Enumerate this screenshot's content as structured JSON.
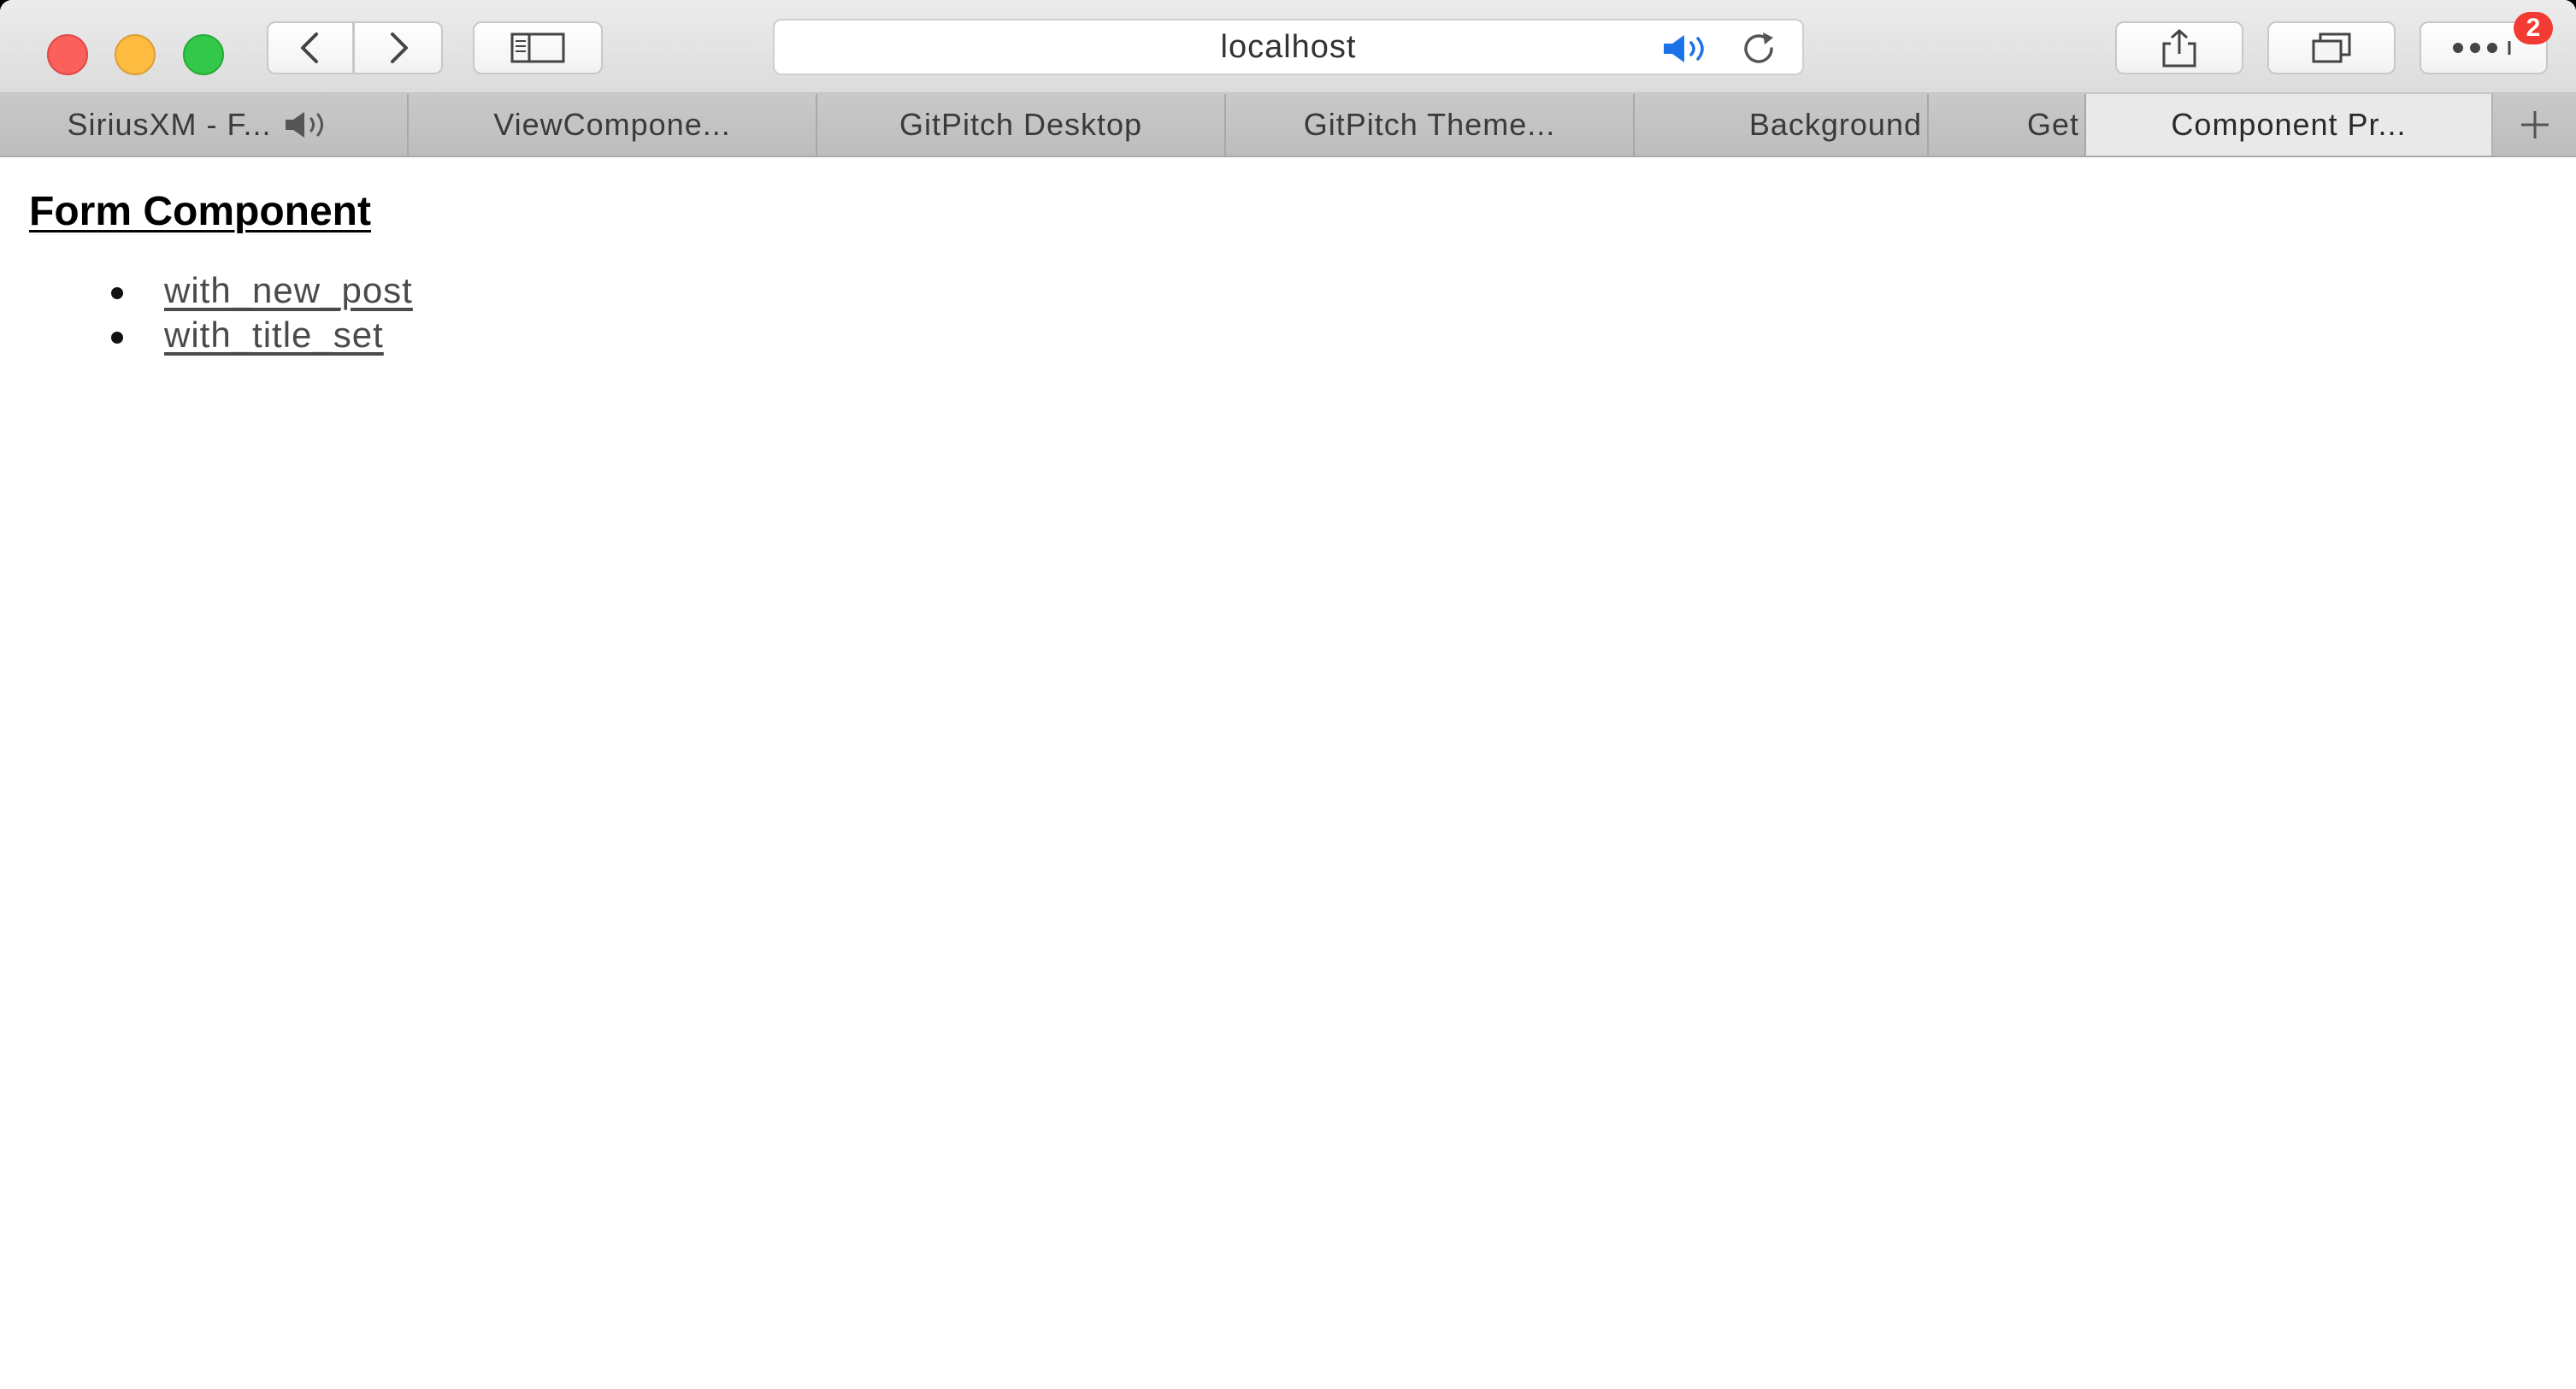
{
  "browser": {
    "address_bar": {
      "url_text": "localhost"
    },
    "more_badge_count": "2",
    "tabs": [
      {
        "label": "SiriusXM - F...",
        "playing_audio": true
      },
      {
        "label": "ViewCompone..."
      },
      {
        "label": "GitPitch Desktop"
      },
      {
        "label": "GitPitch Theme..."
      },
      {
        "label": "Background"
      },
      {
        "label": "Get"
      },
      {
        "label": "Component Pr...",
        "active": true
      }
    ],
    "icons": {
      "back": "chevron-left-icon",
      "forward": "chevron-right-icon",
      "sidebar": "sidebar-icon",
      "audio": "speaker-icon",
      "reload": "reload-icon",
      "share": "share-icon",
      "tab_overview": "tab-overview-icon",
      "more": "ellipsis-icon",
      "new_tab": "plus-icon"
    },
    "colors": {
      "close": "#fc605c",
      "minimize": "#fdbc40",
      "maximize": "#34c84a",
      "audio_accent": "#1a73e8",
      "badge": "#f23b32"
    }
  },
  "page": {
    "title": "Form Component",
    "previews": [
      {
        "label": "with_new_post"
      },
      {
        "label": "with_title_set"
      }
    ]
  }
}
